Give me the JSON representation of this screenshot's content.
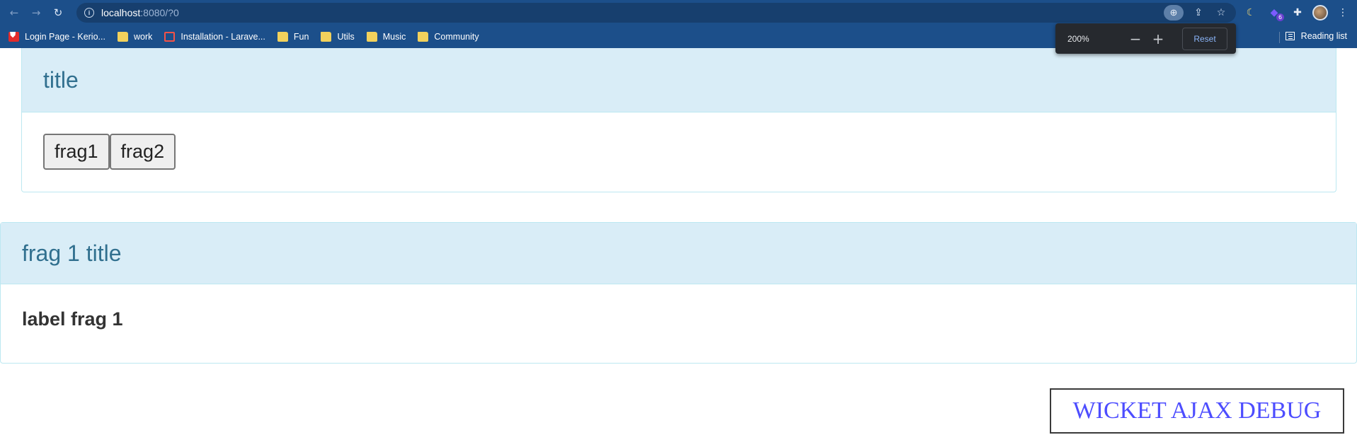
{
  "browser": {
    "url_host": "localhost",
    "url_rest": ":8080/?0",
    "bookmarks": [
      {
        "label": "Login Page - Kerio...",
        "icon": "kerio-shield-icon"
      },
      {
        "label": "work",
        "icon": "folder-icon"
      },
      {
        "label": "Installation - Larave...",
        "icon": "laravel-icon"
      },
      {
        "label": "Fun",
        "icon": "folder-icon"
      },
      {
        "label": "Utils",
        "icon": "folder-icon"
      },
      {
        "label": "Music",
        "icon": "folder-icon"
      },
      {
        "label": "Community",
        "icon": "folder-icon"
      }
    ],
    "reading_list_label": "Reading list",
    "extension_badge": "6",
    "colors": {
      "chrome": "#1c4f8a",
      "omnibox": "#173f6e"
    }
  },
  "zoom_popup": {
    "level": "200%",
    "reset_label": "Reset"
  },
  "panel_main": {
    "title": "title",
    "buttons": [
      "frag1",
      "frag2"
    ]
  },
  "panel_frag": {
    "title": "frag 1 title",
    "label": "label frag 1"
  },
  "debug_link": "WICKET AJAX DEBUG",
  "colors": {
    "panel_heading_bg": "#d9edf7",
    "panel_heading_text": "#31708f",
    "panel_border": "#bce8f1",
    "debug_text": "#4d4dff"
  }
}
